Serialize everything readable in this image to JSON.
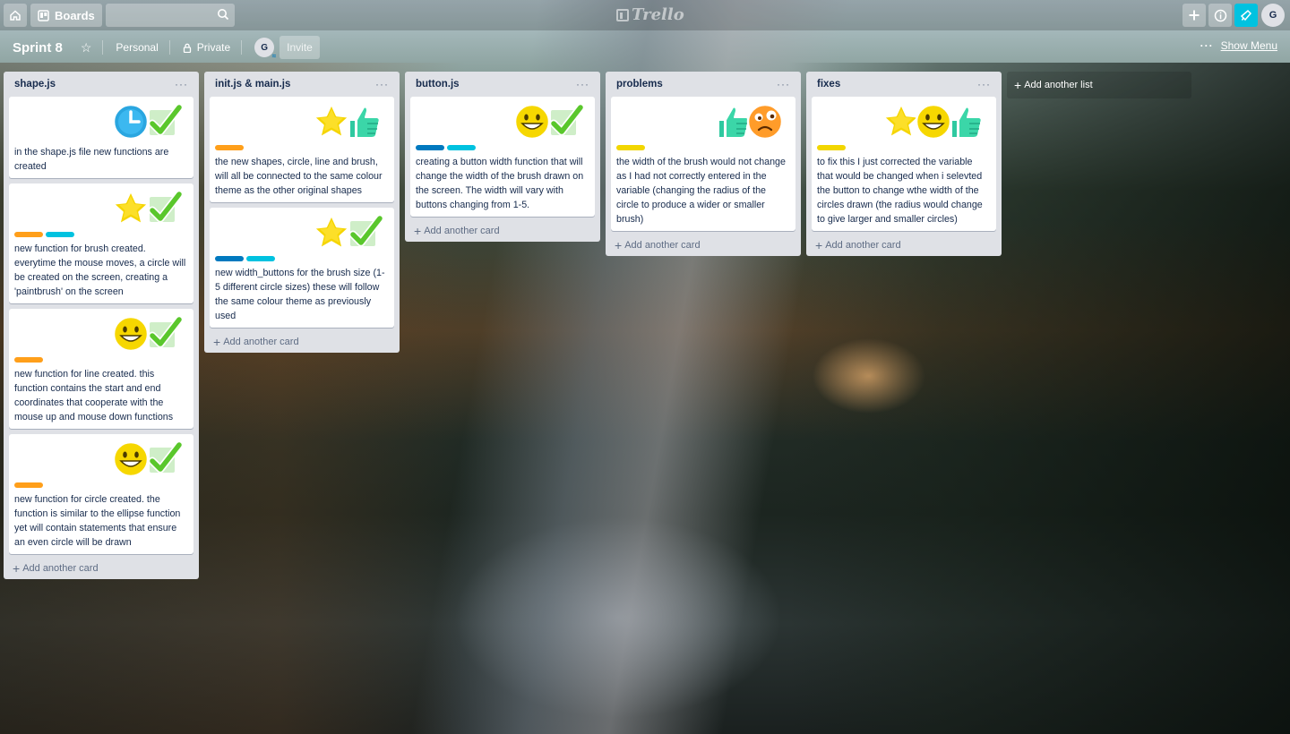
{
  "topbar": {
    "boards_label": "Boards",
    "search_value": "",
    "logo_text": "Trello",
    "avatar_initial": "G"
  },
  "board": {
    "title": "Sprint 8",
    "team": "Personal",
    "visibility": "Private",
    "member_initial": "G",
    "invite_label": "Invite",
    "show_menu_label": "Show Menu",
    "add_list_label": "Add another list"
  },
  "colors": {
    "label_orange": "#ff9f1a",
    "label_sky": "#00c2e0",
    "label_blue": "#0079bf",
    "label_yellow": "#f2d600",
    "notify": "#00c2e0"
  },
  "lists": [
    {
      "title": "shape.js",
      "add_card": "Add another card",
      "cards": [
        {
          "stickers": [
            "clock",
            "check"
          ],
          "labels": [],
          "text": "in the shape.js file new functions are created"
        },
        {
          "stickers": [
            "star",
            "check"
          ],
          "labels": [
            "orange",
            "sky"
          ],
          "text": "new function for brush created. everytime the mouse moves, a circle will be created on the screen, creating a 'paintbrush' on the screen"
        },
        {
          "stickers": [
            "smile",
            "check"
          ],
          "labels": [
            "orange"
          ],
          "text": "new function for line created. this function contains the start and end coordinates that cooperate with the mouse up and mouse down functions"
        },
        {
          "stickers": [
            "smile",
            "check"
          ],
          "labels": [
            "orange"
          ],
          "text": "new function for circle created. the function is similar to the ellipse function yet will contain statements that ensure an even circle will be drawn"
        }
      ]
    },
    {
      "title": "init.js & main.js",
      "add_card": "Add another card",
      "cards": [
        {
          "stickers": [
            "star",
            "thumbsup"
          ],
          "labels": [
            "orange"
          ],
          "text": "the new shapes, circle, line and brush, will all be connected to the same colour theme as the other original shapes"
        },
        {
          "stickers": [
            "star",
            "check"
          ],
          "labels": [
            "blue",
            "sky"
          ],
          "text": "new width_buttons for the brush size (1-5 different circle sizes) these will follow the same colour theme as previously used"
        }
      ]
    },
    {
      "title": "button.js",
      "add_card": "Add another card",
      "cards": [
        {
          "stickers": [
            "smile",
            "check"
          ],
          "labels": [
            "blue",
            "sky"
          ],
          "text": "creating a button width function that will change the width of the brush drawn on the screen. The width will vary with buttons changing from 1-5."
        }
      ]
    },
    {
      "title": "problems",
      "add_card": "Add another card",
      "cards": [
        {
          "stickers": [
            "thumbsup",
            "frown"
          ],
          "labels": [
            "yellow"
          ],
          "text": "the width of the brush would not change as I had not correctly entered in the variable (changing the radius of the circle to produce a wider or smaller brush)"
        }
      ]
    },
    {
      "title": "fixes",
      "add_card": "Add another card",
      "cards": [
        {
          "stickers": [
            "star",
            "smile",
            "thumbsup"
          ],
          "labels": [
            "yellow"
          ],
          "text": "to fix this I just corrected the variable that would be changed when i selevted the button to change wthe width of the circles drawn (the radius would change to give larger and smaller circles)"
        }
      ]
    }
  ]
}
